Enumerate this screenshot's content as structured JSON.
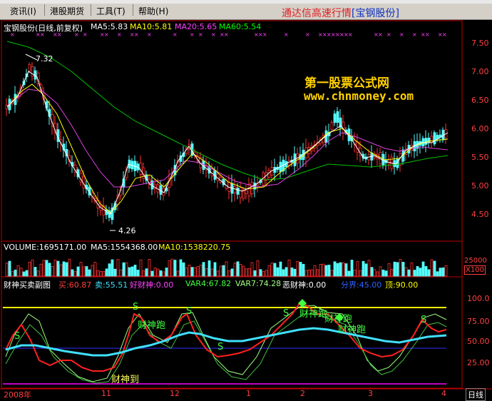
{
  "menu": {
    "items": [
      {
        "label": "资讯(I)"
      },
      {
        "label": "港股期货"
      },
      {
        "label": "工具(T)"
      },
      {
        "label": "帮助(H)"
      }
    ],
    "brand": "通达信高速行情",
    "brand_stock": "[宝钢股份]"
  },
  "main_panel": {
    "title": "宝钢股份(日线,前复权)",
    "ma5": "MA5:5.83",
    "ma10": "MA10:5.81",
    "ma20": "MA20:5.65",
    "ma60": "MA60:5.54",
    "high_marker": "7.32",
    "low_marker": "4.26",
    "price_ticks": [
      "7.50",
      "7.00",
      "6.50",
      "6.00",
      "5.50",
      "5.00",
      "4.50"
    ]
  },
  "volume_panel": {
    "volume": "VOLUME:1695171.00",
    "ma5": "MA5:1554368.00",
    "ma10": "MA10:1538220.75",
    "tick": "25000",
    "unit": "X100"
  },
  "indicator_panel": {
    "name": "财神买卖副图",
    "buy": "买:60.87",
    "sell": "卖:55.51",
    "good": "好财神:0.00",
    "var4": "VAR4:67.82",
    "var7": "VAR7:74.28",
    "bad": "恶财神:0.00",
    "boundary": "分界:45.00",
    "top": "顶:90.00",
    "ticks": [
      "100.0",
      "75.00",
      "50.00",
      "25.00"
    ],
    "annotations": {
      "arrive": "财神到",
      "run1": "财神跑",
      "run2": "财神跑",
      "run3": "财神跑",
      "run4": "财神跑",
      "s": "S"
    }
  },
  "date_axis": {
    "labels": [
      "2008年",
      "11",
      "12",
      "1",
      "2",
      "3",
      "4"
    ],
    "period": "日线"
  },
  "watermark": {
    "line1": "第一股票公式网",
    "line2": "www.chnmoney.com"
  },
  "colors": {
    "price_axis": "#c00000",
    "ma5": "#ffffff",
    "ma10": "#ffff00",
    "ma20": "#ff00ff",
    "ma60": "#00ff00",
    "up_candle": "#ff3232",
    "down_candle": "#54ffff",
    "buy_line": "#ff2020",
    "sell_line": "#40e0ff",
    "top_line": "#ffff00",
    "bottom_line": "#c000c0"
  }
}
